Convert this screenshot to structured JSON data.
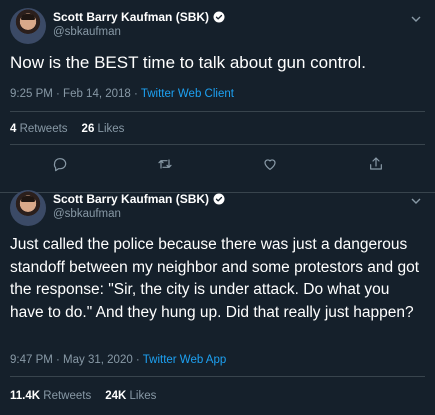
{
  "tweets": [
    {
      "name": "Scott Barry Kaufman (SBK)",
      "handle": "@sbkaufman",
      "text": "Now is the BEST time to talk about gun control.",
      "time": "9:25 PM · Feb 14, 2018 · ",
      "client": "Twitter Web Client",
      "retweets_count": "4",
      "retweets_label": "Retweets",
      "likes_count": "26",
      "likes_label": "Likes"
    },
    {
      "name": "Scott Barry Kaufman (SBK)",
      "handle": "@sbkaufman",
      "text": "Just called the police because there was just a dangerous standoff between my neighbor and some protestors and got the response: \"Sir, the city is under attack. Do what you have to do.\" And they hung up. Did that really just happen?",
      "time": "9:47 PM · May 31, 2020 · ",
      "client": "Twitter Web App",
      "retweets_count": "11.4K",
      "retweets_label": "Retweets",
      "likes_count": "24K",
      "likes_label": "Likes"
    }
  ],
  "icons": {
    "reply": "reply-icon",
    "retweet": "retweet-icon",
    "like": "like-icon",
    "share": "share-icon",
    "verified": "verified-badge-icon",
    "more": "chevron-down-icon"
  },
  "colors": {
    "background": "#15202b",
    "secondary_text": "#8899a6",
    "accent": "#1da1f2",
    "divider": "#38444d"
  }
}
